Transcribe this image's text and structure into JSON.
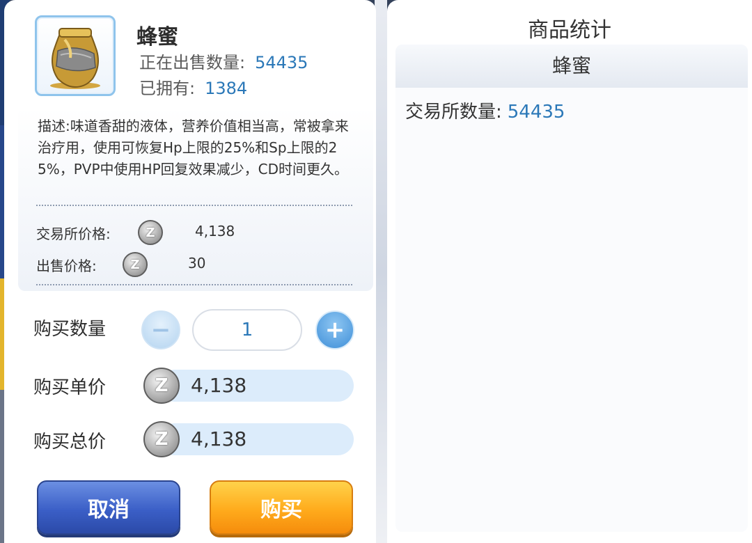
{
  "item": {
    "name": "蜂蜜",
    "on_sale_label": "正在出售数量:",
    "on_sale_value": "54435",
    "owned_label": "已拥有:",
    "owned_value": "1384",
    "icon": "honey-jar-icon"
  },
  "description": "描述:味道香甜的液体，营养价值相当高，常被拿来治疗用，使用可恢复Hp上限的25%和Sp上限的25%，PVP中使用HP回复效果减少，CD时间更久。",
  "prices": {
    "exchange_label": "交易所价格:",
    "exchange_value": "4,138",
    "sell_label": "出售价格:",
    "sell_value": "30",
    "coin_glyph": "Z"
  },
  "purchase": {
    "qty_label": "购买数量",
    "qty_value": "1",
    "minus_symbol": "−",
    "plus_symbol": "+",
    "unit_label": "购买单价",
    "unit_value": "4,138",
    "total_label": "购买总价",
    "total_value": "4,138"
  },
  "buttons": {
    "cancel": "取消",
    "buy": "购买"
  },
  "stats": {
    "title": "商品统计",
    "item_name": "蜂蜜",
    "exchange_qty_label": "交易所数量:",
    "exchange_qty_value": "54435"
  },
  "colors": {
    "value_blue": "#2b78b8",
    "cancel_blue": "#3b5fc7",
    "buy_orange": "#ffab1c"
  }
}
